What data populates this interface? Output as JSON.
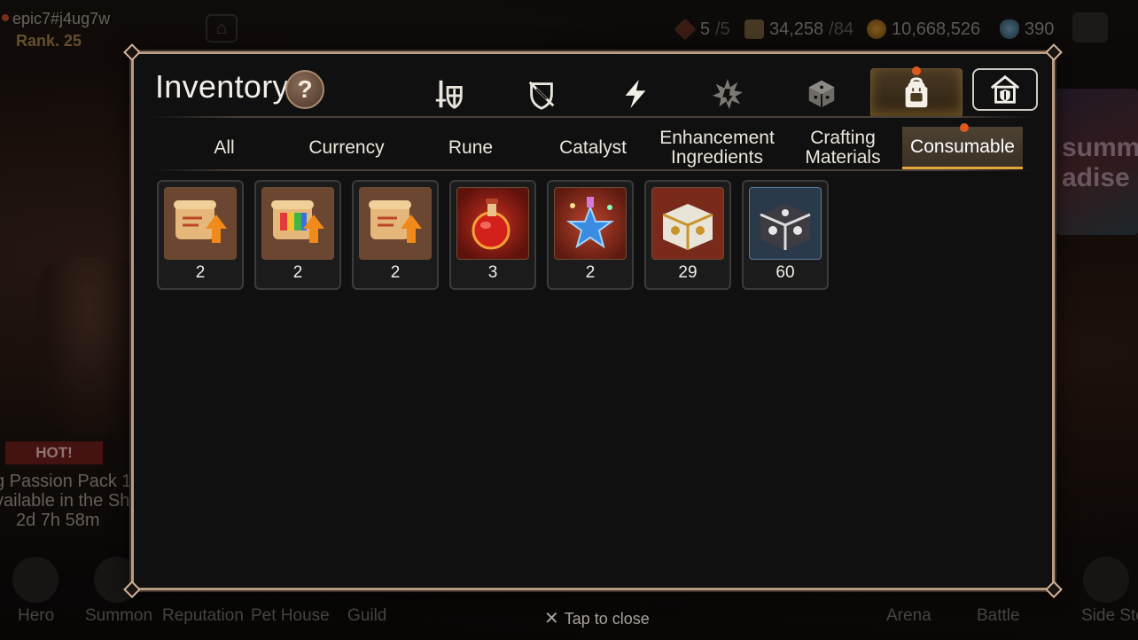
{
  "player": {
    "name": "epic7#j4ug7w",
    "rank": "Rank. 25"
  },
  "resources": {
    "stamina": {
      "value": "5",
      "max": "/5"
    },
    "gold_stack": {
      "value": "34,258",
      "max": "/84"
    },
    "gold": {
      "value": "10,668,526"
    },
    "skystone": {
      "value": "390"
    }
  },
  "promo": {
    "badge": "HOT!",
    "line1": "g Passion Pack 1",
    "line2": "vailable in the Sh",
    "timer": "2d 7h 58m"
  },
  "side_banner": {
    "text": "summ adise"
  },
  "bottom_nav": [
    "Hero",
    "Summon",
    "Reputation",
    "Pet House",
    "Guild",
    "Arena",
    "Battle",
    "Side Sto"
  ],
  "inventory": {
    "title": "Inventory",
    "help_label": "?",
    "category_tabs": [
      {
        "icon": "sword-shield-icon"
      },
      {
        "icon": "broken-shield-icon"
      },
      {
        "icon": "lightning-icon"
      },
      {
        "icon": "burst-icon"
      },
      {
        "icon": "cube-icon"
      },
      {
        "icon": "backpack-icon",
        "active": true,
        "notification": true
      },
      {
        "icon": "house-icon"
      }
    ],
    "sub_tabs": [
      {
        "label": "All"
      },
      {
        "label": "Currency"
      },
      {
        "label": "Rune"
      },
      {
        "label": "Catalyst"
      },
      {
        "label": "Enhancement\nIngredients"
      },
      {
        "label": "Crafting\nMaterials"
      },
      {
        "label": "Consumable",
        "active": true,
        "notification": true
      }
    ],
    "items": [
      {
        "icon": "scroll-upgrade-icon",
        "count": "2"
      },
      {
        "icon": "rainbow-scroll-upgrade-icon",
        "count": "2"
      },
      {
        "icon": "scroll-upgrade-icon",
        "count": "2"
      },
      {
        "icon": "red-potion-icon",
        "count": "3"
      },
      {
        "icon": "star-potion-icon",
        "count": "2"
      },
      {
        "icon": "gold-chest-icon",
        "count": "29"
      },
      {
        "icon": "silver-chest-icon",
        "count": "60"
      }
    ]
  },
  "close_hint": "Tap to close",
  "colors": {
    "accent": "#e1a640",
    "frame": "#b99a82",
    "notification": "#e0581e"
  }
}
